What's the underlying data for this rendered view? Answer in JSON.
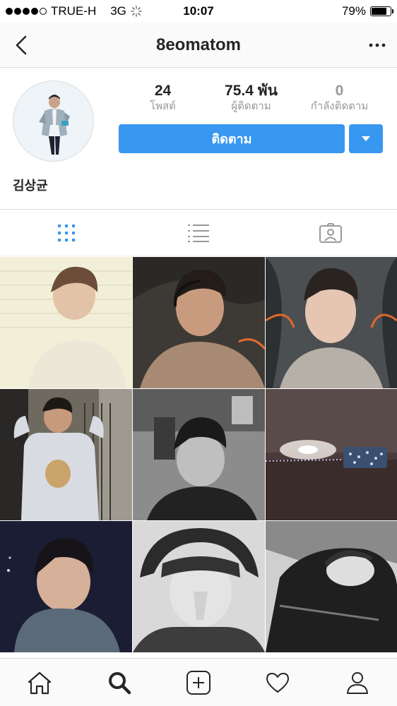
{
  "status_bar": {
    "carrier": "TRUE-H",
    "network": "3G",
    "time": "10:07",
    "battery": "79%",
    "battery_level": 0.79,
    "signal_bars": 4
  },
  "nav": {
    "username": "8eomatom",
    "back_icon": "chevron-left-icon",
    "more_icon": "more-horizontal-icon"
  },
  "profile": {
    "posts_count": "24",
    "posts_label": "โพสต์",
    "followers_count": "75.4 พัน",
    "followers_label": "ผู้ติดตาม",
    "following_count": "0",
    "following_label": "กำลังติดตาม",
    "follow_button": "ติดตาม",
    "full_name": "김상균"
  },
  "tabs": [
    {
      "name": "grid",
      "icon": "grid-icon",
      "active": true
    },
    {
      "name": "list",
      "icon": "list-icon",
      "active": false
    },
    {
      "name": "tagged",
      "icon": "tagged-icon",
      "active": false
    }
  ],
  "bottom_nav": [
    {
      "name": "home",
      "icon": "home-icon"
    },
    {
      "name": "search",
      "icon": "search-icon",
      "active": true
    },
    {
      "name": "add",
      "icon": "add-icon"
    },
    {
      "name": "activity",
      "icon": "heart-icon"
    },
    {
      "name": "profile",
      "icon": "person-icon"
    }
  ],
  "colors": {
    "accent": "#3897f0",
    "text": "#262626",
    "secondary_text": "#999999",
    "border": "#dbdbdb"
  }
}
